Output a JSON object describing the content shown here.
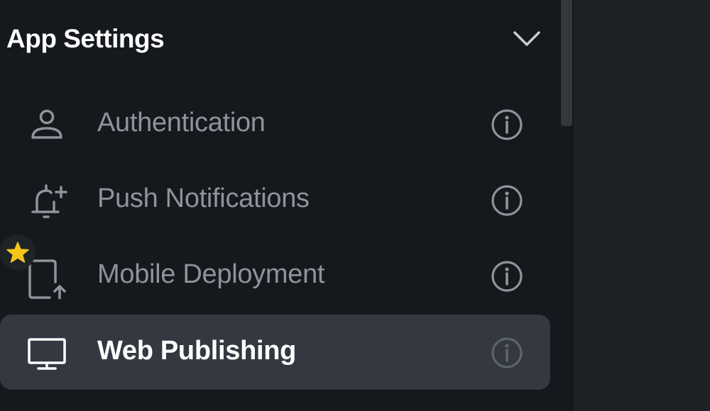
{
  "section": {
    "title": "App Settings",
    "toggle_icon": "chevron-down-icon"
  },
  "nav": {
    "items": [
      {
        "label": "Authentication",
        "icon": "user-icon",
        "info_icon": "info-icon",
        "active": false
      },
      {
        "label": "Push Notifications",
        "icon": "bell-plus-icon",
        "info_icon": "info-icon",
        "active": false
      },
      {
        "label": "Mobile Deployment",
        "icon": "mobile-upload-icon",
        "info_icon": "info-icon",
        "active": false
      },
      {
        "label": "Web Publishing",
        "icon": "monitor-icon",
        "info_icon": "info-icon",
        "active": true
      }
    ]
  },
  "badge": {
    "icon": "star-icon",
    "color": "#f5c518"
  },
  "colors": {
    "sidebar_bg": "#15181c",
    "active_item_bg": "#343841",
    "text_muted": "#8d949a",
    "text_active": "#ffffff"
  }
}
